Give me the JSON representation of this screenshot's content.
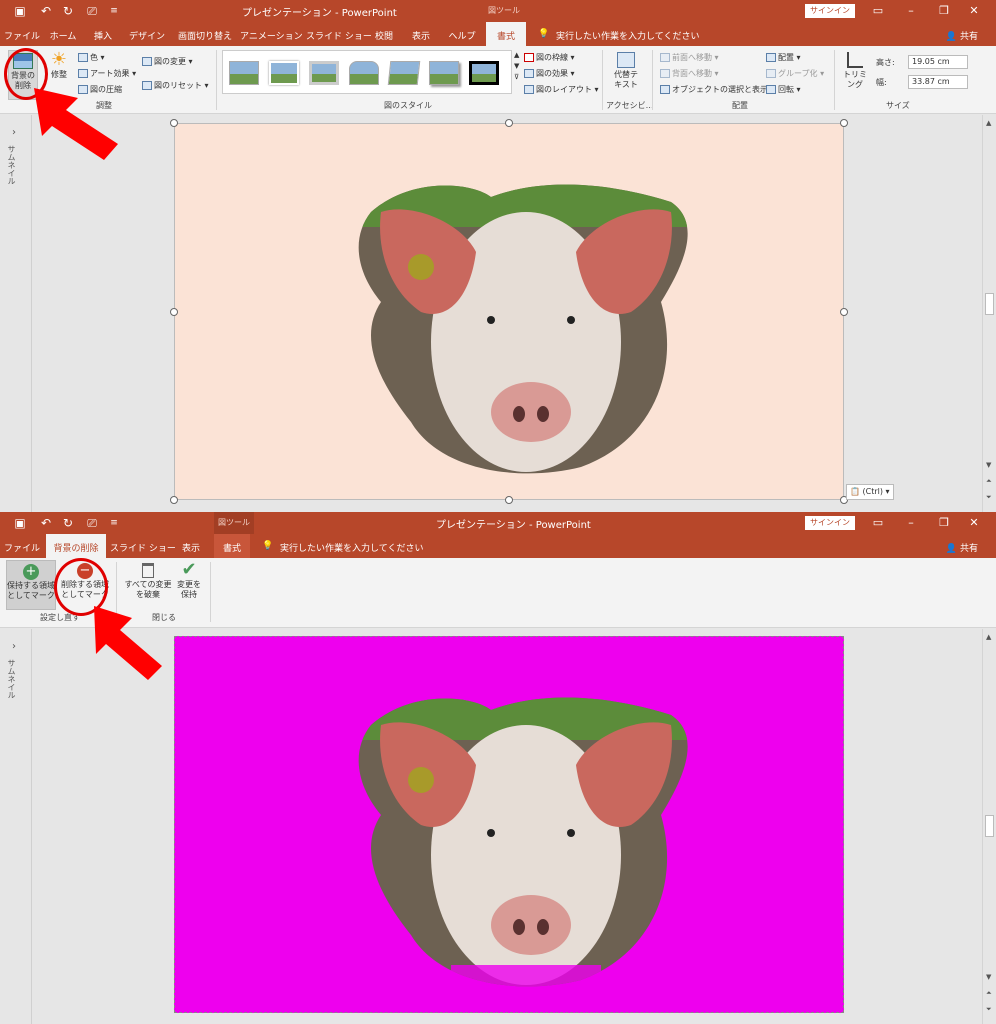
{
  "top": {
    "titlebar": {
      "title": "プレゼンテーション - PowerPoint",
      "context_tool": "図ツール",
      "signin": "サインイン",
      "undo_icon": "↶",
      "redo_icon": "↻"
    },
    "tabs": [
      "ファイル",
      "ホーム",
      "挿入",
      "デザイン",
      "画面切り替え",
      "アニメーション",
      "スライド ショー",
      "校閲",
      "表示",
      "ヘルプ",
      "書式"
    ],
    "active_tab": "書式",
    "tellme": "実行したい作業を入力してください",
    "share": "共有",
    "ribbon": {
      "remove_bg": "背景の\n削除",
      "corrections": "修整",
      "color": "色",
      "artistic": "アート効果",
      "compress": "図の圧縮",
      "change_pic": "図の変更",
      "reset_pic": "図のリセット",
      "group_adjust": "調整",
      "group_styles": "図のスタイル",
      "border": "図の枠線",
      "effects": "図の効果",
      "layout": "図のレイアウト",
      "alt_text": "代替テ\nキスト",
      "group_access": "アクセシビ…",
      "bring_forward": "前面へ移動",
      "send_backward": "背面へ移動",
      "selection_pane": "オブジェクトの選択と表示",
      "align": "配置",
      "group": "グループ化",
      "rotate": "回転",
      "group_arrange": "配置",
      "crop": "トリミング",
      "height_label": "高さ:",
      "height_value": "19.05 cm",
      "width_label": "幅:",
      "width_value": "33.87 cm",
      "group_size": "サイズ"
    },
    "thumbnail_label": "サムネイル",
    "paste_options": "(Ctrl)",
    "slide_bg_color": "#fbe3d6"
  },
  "bottom": {
    "titlebar": {
      "title": "プレゼンテーション - PowerPoint",
      "context_tool": "図ツール",
      "signin": "サインイン"
    },
    "tabs": [
      "ファイル",
      "背景の削除",
      "スライド ショー",
      "表示",
      "書式"
    ],
    "active_tab": "背景の削除",
    "tellme": "実行したい作業を入力してください",
    "share": "共有",
    "ribbon": {
      "mark_keep": "保持する領域\nとしてマーク",
      "mark_remove": "削除する領域\nとしてマーク",
      "group_refine": "設定し直す",
      "discard_all": "すべての変更\nを破棄",
      "keep_changes": "変更を\n保持",
      "group_close": "閉じる"
    },
    "thumbnail_label": "サムネイル",
    "slide_bg_color": "#ee00ee"
  },
  "colors": {
    "accent": "#b7472a",
    "highlight": "#e00000"
  }
}
